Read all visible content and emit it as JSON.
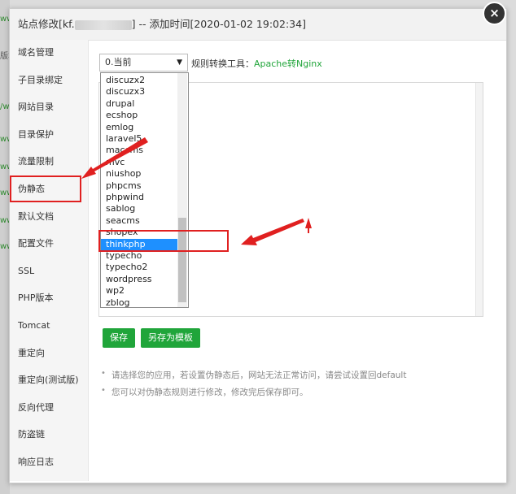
{
  "dialog": {
    "title_prefix": "站点修改[kf.",
    "title_suffix": "] -- 添加时间[2020-01-02 19:02:34]",
    "close_glyph": "×"
  },
  "background_rows": [
    {
      "text": "www",
      "color": "green"
    },
    {
      "text": "版本",
      "color": "dark"
    },
    {
      "text": "/ww",
      "color": "green"
    },
    {
      "text": "www",
      "color": "green"
    },
    {
      "text": "www",
      "color": "green"
    },
    {
      "text": "www",
      "color": "green"
    },
    {
      "text": "www",
      "color": "green"
    },
    {
      "text": "www",
      "color": "green"
    }
  ],
  "sidebar": {
    "items": [
      {
        "label": "域名管理"
      },
      {
        "label": "子目录绑定"
      },
      {
        "label": "网站目录"
      },
      {
        "label": "目录保护"
      },
      {
        "label": "流量限制"
      },
      {
        "label": "伪静态"
      },
      {
        "label": "默认文档"
      },
      {
        "label": "配置文件"
      },
      {
        "label": "SSL"
      },
      {
        "label": "PHP版本"
      },
      {
        "label": "Tomcat"
      },
      {
        "label": "重定向"
      },
      {
        "label": "重定向(测试版)"
      },
      {
        "label": "反向代理"
      },
      {
        "label": "防盗链"
      },
      {
        "label": "响应日志"
      }
    ],
    "active_index": 5
  },
  "rewrite": {
    "selected_value": "0.当前",
    "tool_label": "规则转换工具：",
    "tool_link": "Apache转Nginx",
    "options": [
      "discuzx2",
      "discuzx3",
      "drupal",
      "ecshop",
      "emlog",
      "laravel5",
      "maccms",
      "mvc",
      "niushop",
      "phpcms",
      "phpwind",
      "sablog",
      "seacms",
      "shopex",
      "thinkphp",
      "typecho",
      "typecho2",
      "wordpress",
      "wp2",
      "zblog"
    ],
    "highlighted_option": "thinkphp",
    "save_button": "保存",
    "save_as_template_button": "另存为模板",
    "notes": [
      "请选择您的应用，若设置伪静态后，网站无法正常访问，请尝试设置回default",
      "您可以对伪静态规则进行修改，修改完后保存即可。"
    ]
  },
  "colors": {
    "accent": "#20a53a",
    "annotation": "#e02020",
    "highlight": "#1e90ff"
  }
}
